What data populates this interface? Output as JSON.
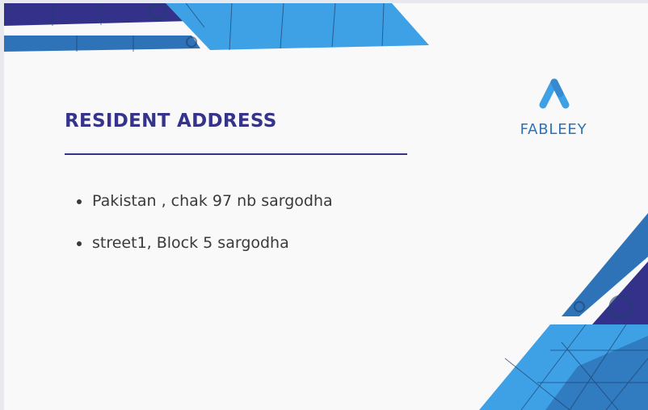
{
  "slide": {
    "title": "RESIDENT ADDRESS",
    "bullets": [
      "Pakistan , chak 97 nb sargodha",
      "street1, Block 5 sargodha"
    ]
  },
  "logo": {
    "name": "FABLEEY",
    "icon": "fableey-logo-icon"
  },
  "colors": {
    "title": "#35338a",
    "accent_blue": "#3ea1e6",
    "mid_blue": "#2e73b8",
    "dark_indigo": "#34318a",
    "background": "#f9f9f9"
  }
}
